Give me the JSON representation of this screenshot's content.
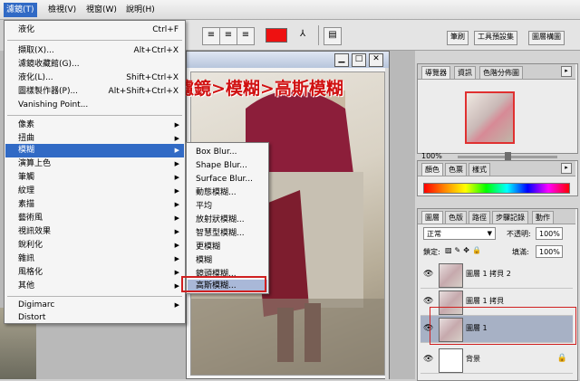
{
  "menubar": {
    "items": [
      "濾鏡(T)",
      "檢視(V)",
      "視窗(W)",
      "說明(H)"
    ]
  },
  "menu": {
    "items": [
      {
        "label": "液化",
        "shortcut": "Ctrl+F"
      },
      {
        "label": "擷取(X)...",
        "shortcut": "Alt+Ctrl+X"
      },
      {
        "label": "濾鏡收藏館(G)...",
        "shortcut": ""
      },
      {
        "label": "液化(L)...",
        "shortcut": "Shift+Ctrl+X"
      },
      {
        "label": "圖樣製作器(P)...",
        "shortcut": "Alt+Shift+Ctrl+X"
      },
      {
        "label": "Vanishing Point...",
        "shortcut": ""
      },
      {
        "label": "像素",
        "submenu": true
      },
      {
        "label": "扭曲",
        "submenu": true
      },
      {
        "label": "模糊",
        "submenu": true
      },
      {
        "label": "演算上色",
        "submenu": true
      },
      {
        "label": "筆觸",
        "submenu": true
      },
      {
        "label": "紋理",
        "submenu": true
      },
      {
        "label": "素描",
        "submenu": true
      },
      {
        "label": "藝術風",
        "submenu": true
      },
      {
        "label": "視訊效果",
        "submenu": true
      },
      {
        "label": "銳利化",
        "submenu": true
      },
      {
        "label": "雜訊",
        "submenu": true
      },
      {
        "label": "風格化",
        "submenu": true
      },
      {
        "label": "其他",
        "submenu": true
      },
      {
        "label": "Digimarc",
        "submenu": true
      },
      {
        "label": "Distort",
        "submenu": false
      }
    ]
  },
  "submenu": {
    "items": [
      "Box Blur...",
      "Shape Blur...",
      "Surface Blur...",
      "動態模糊...",
      "平均",
      "放射狀模糊...",
      "智慧型模糊...",
      "更模糊",
      "模糊",
      "鏡頭模糊...",
      "高斯模糊..."
    ]
  },
  "annotation": "濾鏡>模糊>高斯模糊",
  "toolbar": {
    "color": "#ee1111",
    "tabs": [
      "筆刷",
      "工具預設集",
      "圖層構圖"
    ]
  },
  "navigator": {
    "tabs": [
      "導覽器",
      "資訊",
      "色階分佈圖"
    ],
    "zoom": "100%"
  },
  "color_panel": {
    "tabs": [
      "顏色",
      "色票",
      "樣式"
    ]
  },
  "layers": {
    "tabs": [
      "圖層",
      "色版",
      "路徑",
      "步驟記錄",
      "動作"
    ],
    "blend_mode": "正常",
    "opacity_label": "不透明:",
    "opacity": "100%",
    "lock_label": "鎖定:",
    "fill_label": "填滿:",
    "fill": "100%",
    "rows": [
      {
        "name": "圖層 1 拷貝 2",
        "lock": ""
      },
      {
        "name": "圖層 1 拷貝",
        "lock": ""
      },
      {
        "name": "圖層 1",
        "lock": ""
      },
      {
        "name": "背景",
        "lock": "🔒"
      }
    ]
  }
}
